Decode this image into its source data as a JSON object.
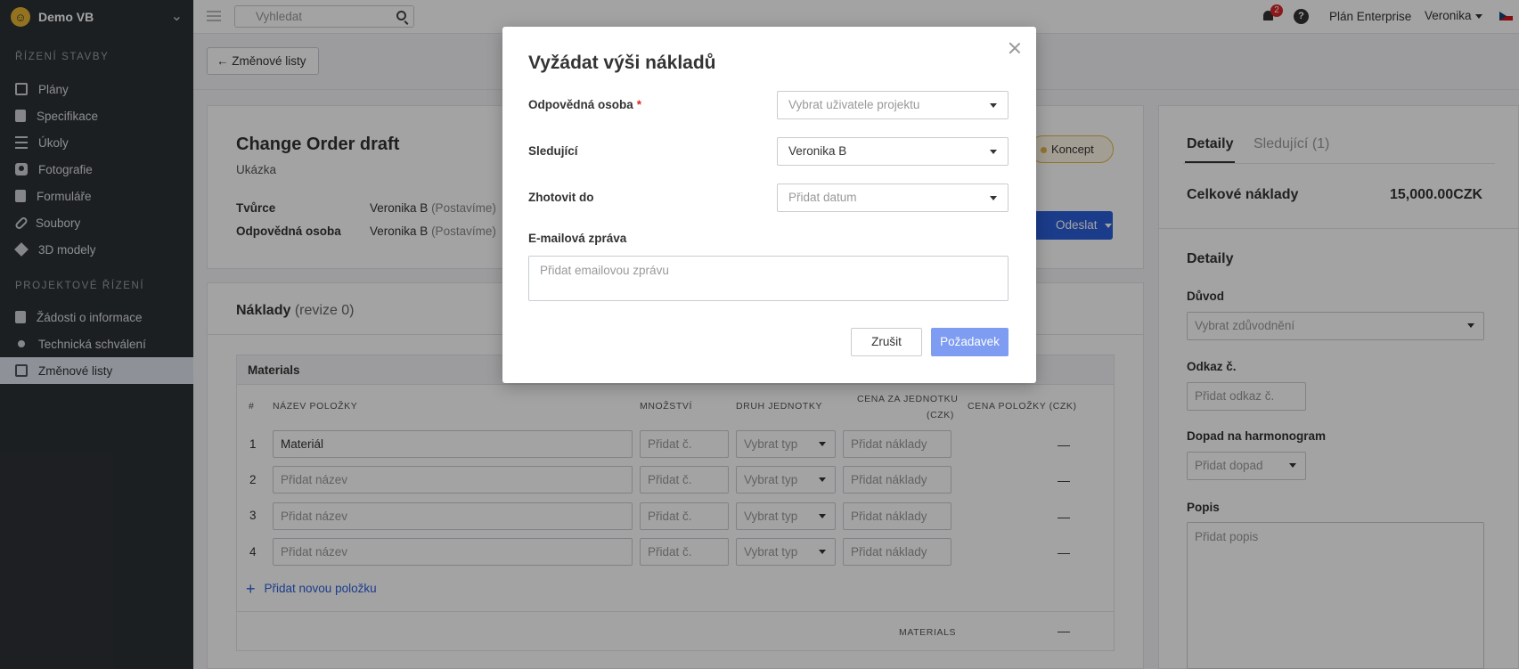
{
  "sidebar": {
    "brand": "Demo VB",
    "section1": "ŘÍZENÍ STAVBY",
    "section2": "PROJEKTOVÉ ŘÍZENÍ",
    "items": [
      {
        "label": "Plány",
        "icon": "plans-icon"
      },
      {
        "label": "Specifikace",
        "icon": "specs-icon"
      },
      {
        "label": "Úkoly",
        "icon": "tasks-icon"
      },
      {
        "label": "Fotografie",
        "icon": "camera-icon"
      },
      {
        "label": "Formuláře",
        "icon": "forms-icon"
      },
      {
        "label": "Soubory",
        "icon": "paperclip-icon"
      },
      {
        "label": "3D modely",
        "icon": "cube-icon"
      },
      {
        "label": "Žádosti o informace",
        "icon": "document-icon"
      },
      {
        "label": "Technická schválení",
        "icon": "user-icon"
      },
      {
        "label": "Změnové listy",
        "icon": "change-order-icon",
        "active": true
      }
    ]
  },
  "topbar": {
    "search_placeholder": "Vyhledat",
    "notifications": "2",
    "help": "?",
    "plan": "Plán Enterprise",
    "user": "Veronika"
  },
  "page": {
    "back_label": "Změnové listy",
    "title": "Change Order draft",
    "subtitle": "Ukázka",
    "creator_label": "Tvůrce",
    "creator_value": "Veronika B",
    "creator_org": "(Postavíme)",
    "resp_label": "Odpovědná osoba",
    "resp_value": "Veronika B",
    "resp_org": "(Postavíme)",
    "status": "Koncept",
    "send_label": "Odeslat"
  },
  "costs": {
    "title": "Náklady",
    "revision": "(revize 0)",
    "group": "Materials",
    "columns": [
      "#",
      "NÁZEV POLOŽKY",
      "MNOŽSTVÍ",
      "DRUH JEDNOTKY",
      "CENA ZA JEDNOTKU",
      "(CZK)",
      "CENA POLOŽKY (CZK)"
    ],
    "rows": [
      {
        "n": "1",
        "name": "Materiál",
        "qty": "Přidat č.",
        "unit": "Vybrat typ",
        "price": "Přidat náklady",
        "total": "—"
      },
      {
        "n": "2",
        "name": "Přidat název",
        "qty": "Přidat č.",
        "unit": "Vybrat typ",
        "price": "Přidat náklady",
        "total": "—"
      },
      {
        "n": "3",
        "name": "Přidat název",
        "qty": "Přidat č.",
        "unit": "Vybrat typ",
        "price": "Přidat náklady",
        "total": "—"
      },
      {
        "n": "4",
        "name": "Přidat název",
        "qty": "Přidat č.",
        "unit": "Vybrat typ",
        "price": "Přidat náklady",
        "total": "—"
      }
    ],
    "add_item": "Přidat novou položku",
    "footer_label": "MATERIALS",
    "footer_total": "—"
  },
  "panel": {
    "tab_details": "Detaily",
    "tab_watchers": "Sledující (1)",
    "total_label": "Celkové náklady",
    "total_value": "15,000.00",
    "currency": "CZK",
    "details_title": "Detaily",
    "reason_label": "Důvod",
    "reason_placeholder": "Vybrat zdůvodnění",
    "ref_label": "Odkaz č.",
    "ref_placeholder": "Přidat odkaz č.",
    "impact_label": "Dopad na harmonogram",
    "impact_placeholder": "Přidat dopad",
    "desc_label": "Popis",
    "desc_placeholder": "Přidat popis"
  },
  "modal": {
    "title": "Vyžádat výši nákladů",
    "resp_label": "Odpovědná osoba",
    "required_mark": "*",
    "resp_placeholder": "Vybrat uživatele projektu",
    "watchers_label": "Sledující",
    "watchers_value": "Veronika B",
    "due_label": "Zhotovit do",
    "due_placeholder": "Přidat datum",
    "email_label": "E-mailová zpráva",
    "email_placeholder": "Přidat emailovou zprávu",
    "cancel": "Zrušit",
    "submit": "Požadavek"
  }
}
